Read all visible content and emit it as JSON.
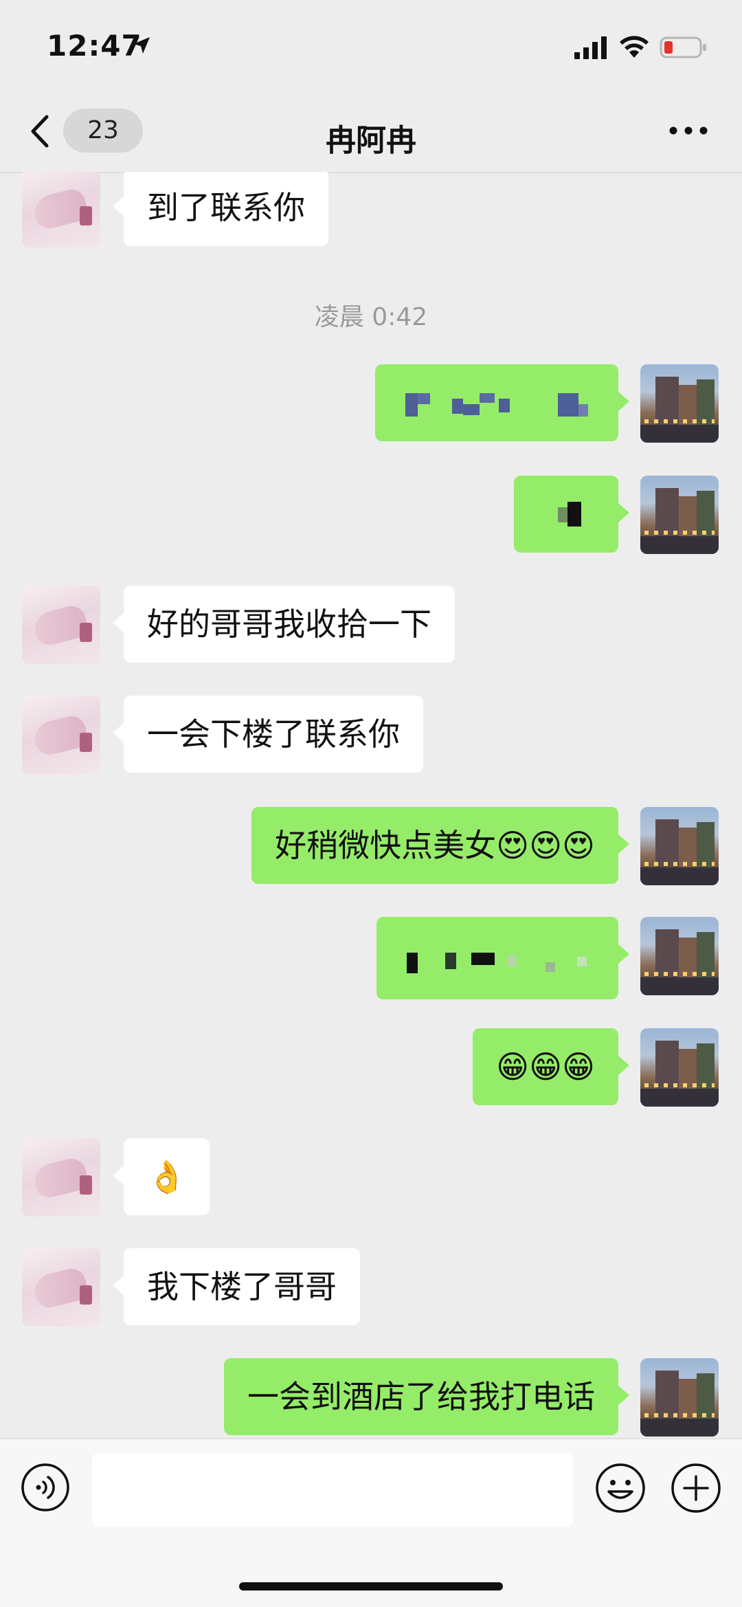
{
  "status_bar": {
    "time": "12:47"
  },
  "nav": {
    "unread_count": "23",
    "title": "冉阿冉"
  },
  "timestamp": "凌晨 0:42",
  "messages": {
    "m1": "到了联系你",
    "m4": "好的哥哥我收拾一下",
    "m5": "一会下楼了联系你",
    "m6": "好稍微快点美女😍😍😍",
    "m8": "😁😁😁",
    "m9": "👌",
    "m10": "我下楼了哥哥",
    "m11": "一会到酒店了给我打电话"
  },
  "colors": {
    "outgoing_bubble": "#95ec69",
    "incoming_bubble": "#ffffff",
    "background": "#ededed"
  },
  "icons": [
    "location-arrow-icon",
    "signal-icon",
    "wifi-icon",
    "battery-icon",
    "back-chevron-icon",
    "more-icon",
    "voice-icon",
    "emoji-icon",
    "plus-icon"
  ]
}
